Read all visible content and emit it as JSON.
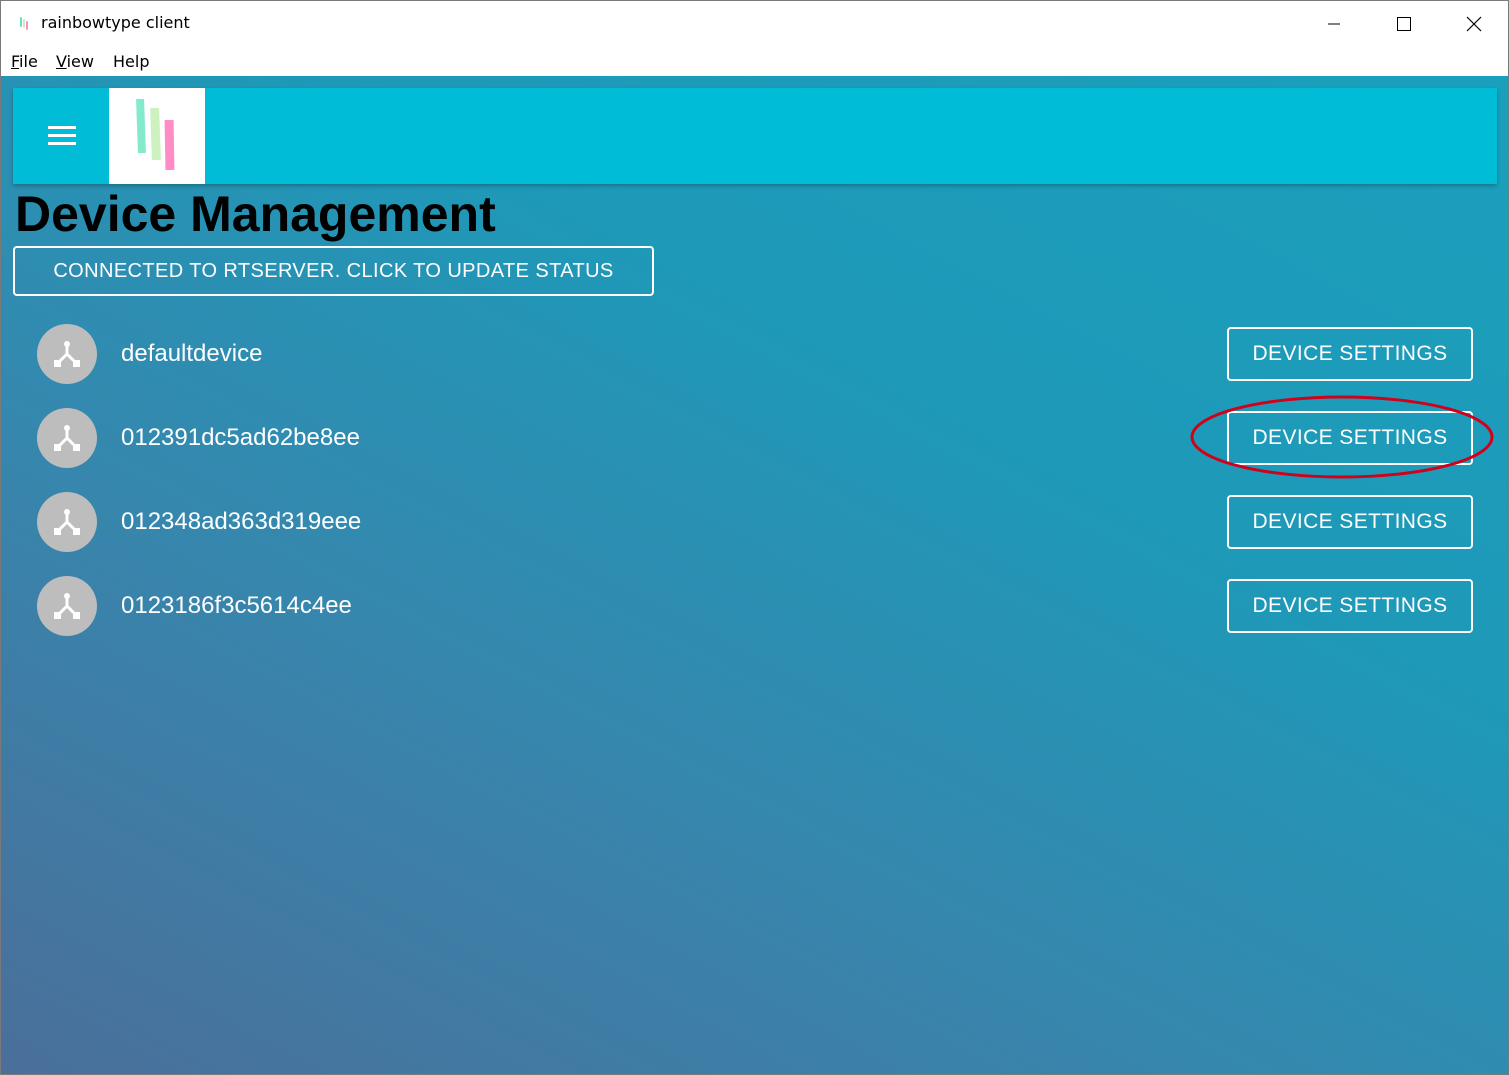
{
  "window": {
    "title": "rainbowtype client",
    "app_icon": "rainbowtype-logo-icon",
    "controls": {
      "minimize_icon": "minimize-icon",
      "maximize_icon": "maximize-icon",
      "close_icon": "close-icon"
    }
  },
  "menubar": {
    "file": {
      "mnemonic": "F",
      "rest": "ile"
    },
    "view": {
      "mnemonic": "V",
      "rest": "iew"
    },
    "help": {
      "label": "Help"
    }
  },
  "appbar": {
    "menu_icon": "hamburger-menu-icon",
    "logo": "rainbowtype-logo",
    "color": "#00bcd6"
  },
  "page": {
    "title": "Device Management",
    "status_button": "CONNECTED TO RTSERVER. CLICK TO UPDATE STATUS"
  },
  "devices": [
    {
      "name": "defaultdevice",
      "icon": "device-hub-icon",
      "action": "DEVICE SETTINGS"
    },
    {
      "name": "012391dc5ad62be8ee",
      "icon": "device-hub-icon",
      "action": "DEVICE SETTINGS"
    },
    {
      "name": "012348ad363d319eee",
      "icon": "device-hub-icon",
      "action": "DEVICE SETTINGS"
    },
    {
      "name": "0123186f3c5614c4ee",
      "icon": "device-hub-icon",
      "action": "DEVICE SETTINGS"
    }
  ],
  "colors": {
    "highlight": "#d0021b",
    "background_gradient": [
      "#4a6f9a",
      "#1aa0bc"
    ],
    "avatar": "#bdbdbd"
  }
}
